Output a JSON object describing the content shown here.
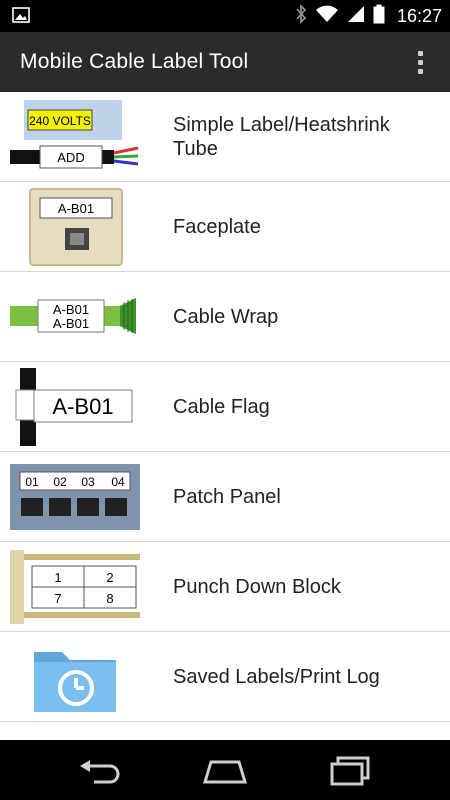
{
  "status_bar": {
    "time": "16:27",
    "icons": [
      "image-notification-icon",
      "bluetooth-icon",
      "wifi-icon",
      "signal-icon",
      "battery-icon"
    ]
  },
  "app_bar": {
    "title": "Mobile Cable Label Tool",
    "menu_icon": "overflow-menu-icon"
  },
  "menu_items": [
    {
      "label": "Simple Label/Heatshrink Tube",
      "thumb_text": [
        "240 VOLTS",
        "ADD"
      ]
    },
    {
      "label": "Faceplate",
      "thumb_text": [
        "A-B01"
      ]
    },
    {
      "label": "Cable Wrap",
      "thumb_text": [
        "A-B01",
        "A-B01"
      ]
    },
    {
      "label": "Cable Flag",
      "thumb_text": [
        "A-B01"
      ]
    },
    {
      "label": "Patch Panel",
      "thumb_text": [
        "01",
        "02",
        "03",
        "04"
      ]
    },
    {
      "label": "Punch Down Block",
      "thumb_text": [
        "1",
        "2",
        "7",
        "8"
      ]
    },
    {
      "label": "Saved Labels/Print Log",
      "thumb_text": []
    }
  ],
  "nav_bar": {
    "buttons": [
      "back-icon",
      "home-icon",
      "recent-apps-icon"
    ]
  },
  "colors": {
    "status_bar": "#000000",
    "action_bar": "#2b2b2b",
    "divider": "#d6d6d6",
    "label_yellow": "#f2f200",
    "cable_green": "#7bc043",
    "folder_blue": "#6fb6e8"
  }
}
